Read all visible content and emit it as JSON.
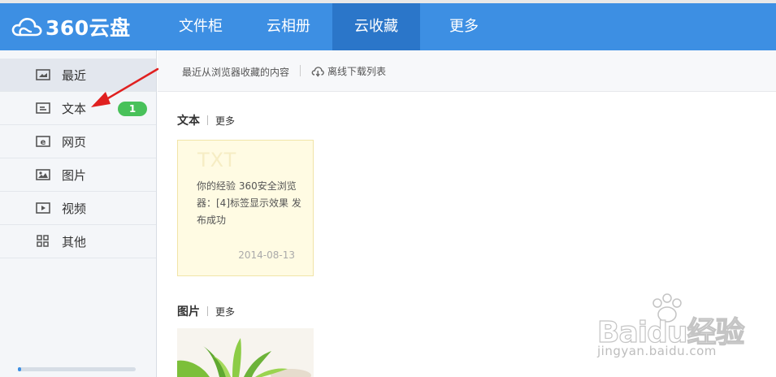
{
  "logo": {
    "text": "360云盘"
  },
  "nav": [
    {
      "label": "文件柜"
    },
    {
      "label": "云相册"
    },
    {
      "label": "云收藏",
      "active": true
    },
    {
      "label": "更多"
    }
  ],
  "sidebar": {
    "items": [
      {
        "label": "最近",
        "icon": "recent-icon",
        "active": true
      },
      {
        "label": "文本",
        "icon": "text-icon",
        "badge": "1"
      },
      {
        "label": "网页",
        "icon": "webpage-icon"
      },
      {
        "label": "图片",
        "icon": "image-icon"
      },
      {
        "label": "视频",
        "icon": "video-icon"
      },
      {
        "label": "其他",
        "icon": "other-grid-icon"
      }
    ],
    "progress_percent": 3
  },
  "toolbar": {
    "description": "最近从浏览器收藏的内容",
    "offline_link": "离线下载列表"
  },
  "sections": {
    "text": {
      "title": "文本",
      "more": "更多"
    },
    "image": {
      "title": "图片",
      "more": "更多"
    }
  },
  "card": {
    "type": "TXT",
    "content": "你的经验 360安全浏览器：[4]标签显示效果 发布成功",
    "date": "2014-08-13"
  },
  "watermark": {
    "brand": "Baidu经验",
    "url": "jingyan.baidu.com"
  },
  "colors": {
    "header": "#3d8fe3",
    "nav_active": "#2b76c9",
    "badge": "#48c15a",
    "arrow": "#e02020"
  }
}
